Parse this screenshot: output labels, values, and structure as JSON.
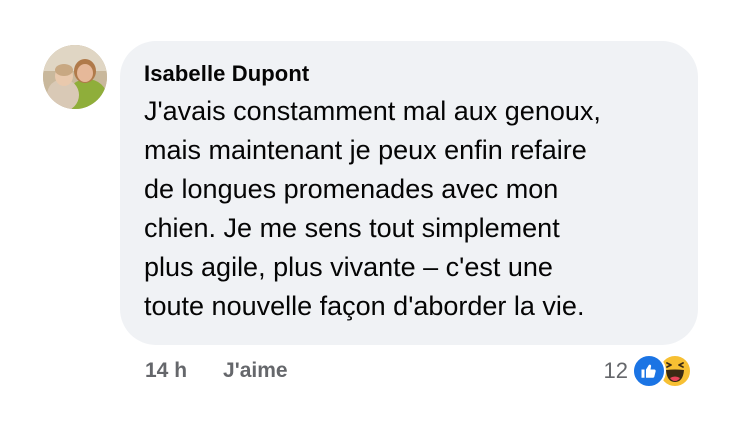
{
  "comment": {
    "author": "Isabelle Dupont",
    "text_lines": [
      "J'avais constamment mal aux genoux,",
      "mais maintenant je peux enfin refaire",
      "de longues promenades avec mon",
      "chien. Je me sens tout simplement",
      "plus agile, plus vivante – c'est une",
      "toute nouvelle façon d'aborder la vie."
    ],
    "timestamp": "14 h",
    "like_label": "J'aime",
    "reaction_count": "12",
    "reactions": [
      "like-icon",
      "haha-icon"
    ]
  },
  "colors": {
    "bubble_bg": "#f0f2f5",
    "text": "#050505",
    "secondary_text": "#65676b",
    "like_blue": "#1b74e4",
    "haha_yellow": "#f7c033"
  }
}
